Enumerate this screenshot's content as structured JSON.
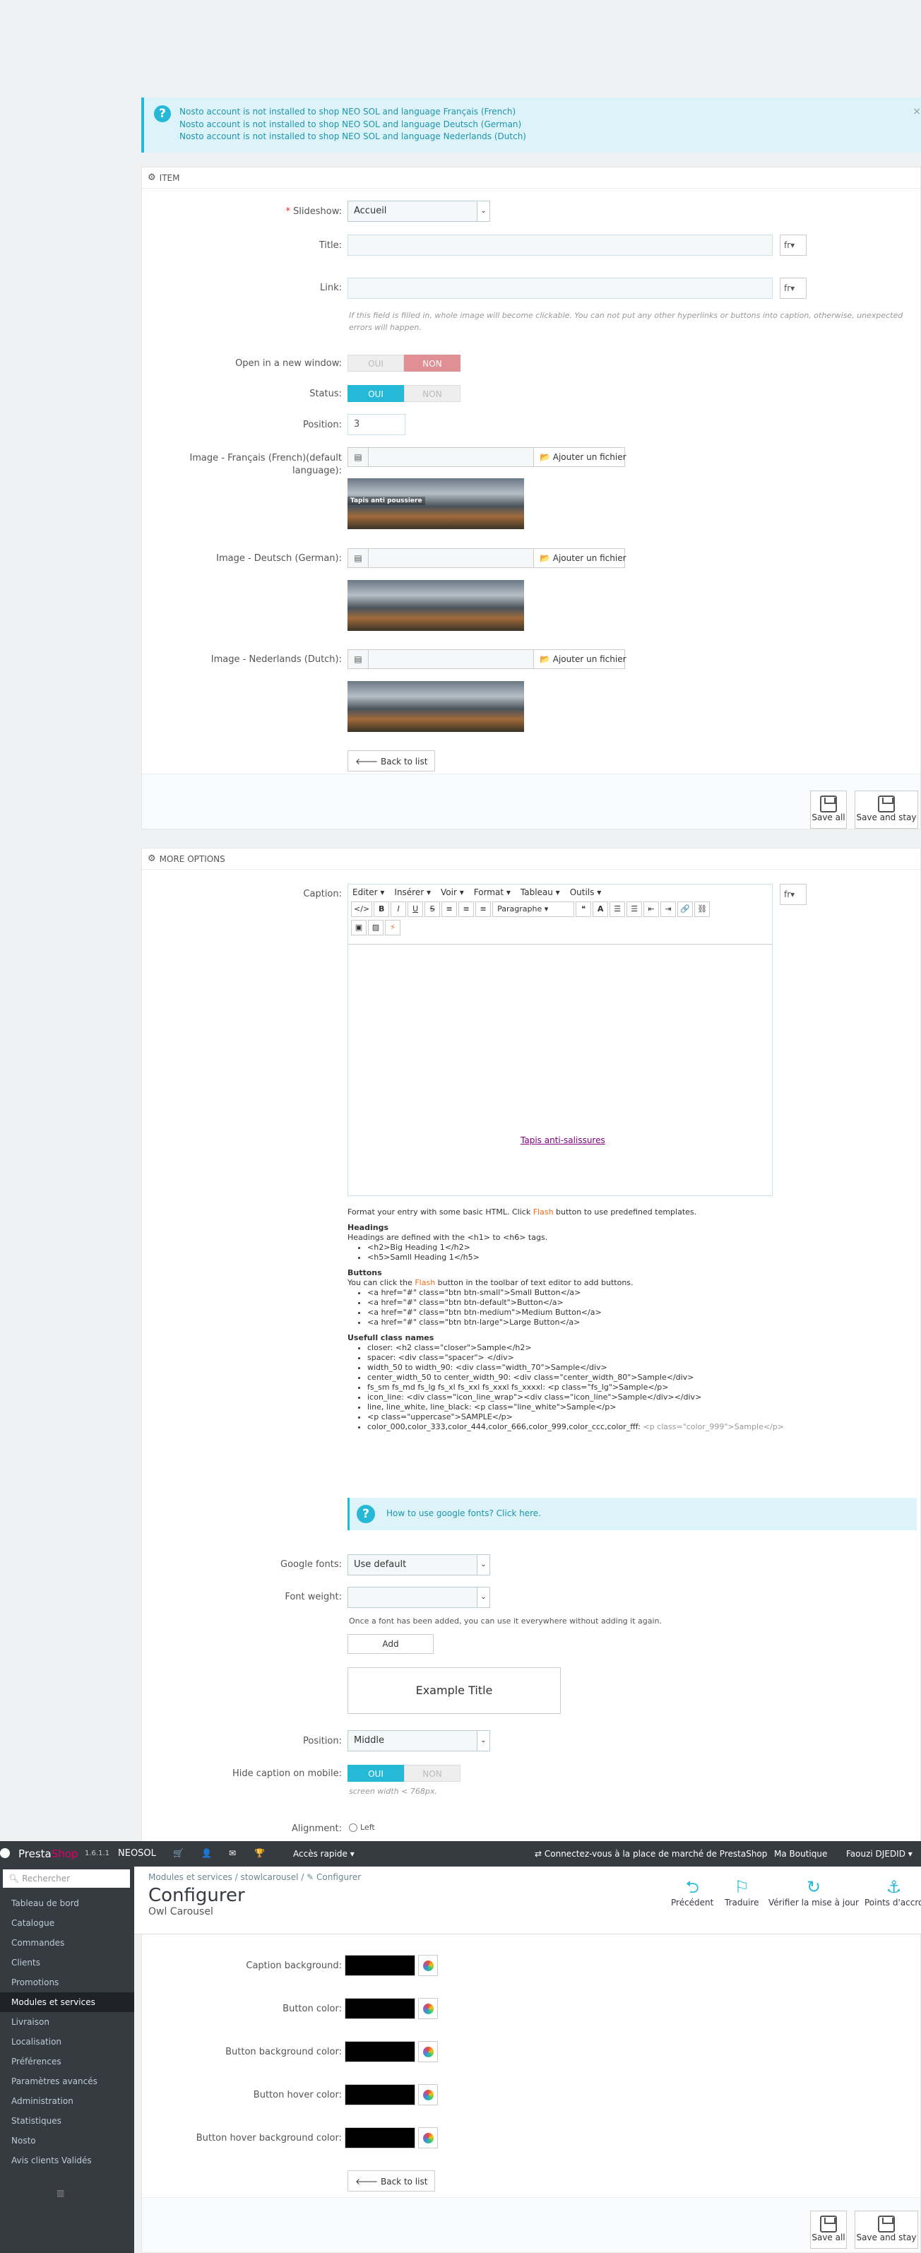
{
  "alert": {
    "lines": [
      "Nosto account is not installed to shop NEO SOL and language Français (French)",
      "Nosto account is not installed to shop NEO SOL and language Deutsch (German)",
      "Nosto account is not installed to shop NEO SOL and language Nederlands (Dutch)"
    ],
    "close": "×"
  },
  "item_panel": {
    "heading": "ITEM",
    "slideshow_label": "Slideshow:",
    "slideshow_value": "Accueil",
    "title_label": "Title:",
    "link_label": "Link:",
    "lang": "fr",
    "link_hint": "If this field is filled in, whole image will become clickable. You can not put any other hyperlinks or buttons into caption, otherwise, unexpected errors will happen.",
    "open_new_label": "Open in a new window:",
    "status_label": "Status:",
    "oui": "OUI",
    "non": "NON",
    "position_label": "Position:",
    "position_value": "3",
    "image_fr_label_1": "Image - Français (French)(default",
    "image_fr_label_2": "language):",
    "image_de_label": "Image - Deutsch (German):",
    "image_nl_label": "Image - Nederlands (Dutch):",
    "add_file": "Ajouter un fichier",
    "thumb_text": "Tapis anti poussiere",
    "back": "Back to list",
    "save_all": "Save all",
    "save_stay": "Save and stay"
  },
  "options_panel": {
    "heading": "MORE OPTIONS",
    "caption_label": "Caption:",
    "lang": "fr",
    "menu": [
      "Editer ▾",
      "Insérer ▾",
      "Voir ▾",
      "Format ▾",
      "Tableau ▾",
      "Outils ▾"
    ],
    "paragraph": "Paragraphe",
    "editor_link": "Tapis anti-salissures",
    "help_intro_1": "Format your entry with some basic HTML. Click ",
    "help_flash": "Flash",
    "help_intro_2": " button to use predefined templates.",
    "headings_title": "Headings",
    "headings_text": "Headings are defined with the <h1> to <h6> tags.",
    "headings_items": [
      "<h2>Big Heading 1</h2>",
      "<h5>Samll Heading 1</h5>"
    ],
    "buttons_title": "Buttons",
    "buttons_text_1": "You can click the ",
    "buttons_text_2": " button in the toolbar of text editor to add buttons.",
    "buttons_items": [
      "<a href=\"#\" class=\"btn btn-small\">Small Button</a>",
      "<a href=\"#\" class=\"btn btn-default\">Button</a>",
      "<a href=\"#\" class=\"btn btn-medium\">Medium Button</a>",
      "<a href=\"#\" class=\"btn btn-large\">Large Button</a>"
    ],
    "classes_title": "Usefull class names",
    "classes_items": [
      "closer: <h2 class=\"closer\">Sample</h2>",
      "spacer: <div class=\"spacer\"> </div>",
      "width_50 to width_90: <div class=\"width_70\">Sample</div>",
      "center_width_50 to center_width_90: <div class=\"center_width_80\">Sample</div>",
      "fs_sm fs_md fs_lg fs_xl fs_xxl fs_xxxl fs_xxxxl: <p class=\"fs_lg\">Sample</p>",
      "icon_line: <div class=\"icon_line_wrap\"><div class=\"icon_line\">Sample</div></div>",
      "line, line_white, line_black: <p class=\"line_white\">Sample</p>",
      "<p class=\"uppercase\">SAMPLE</p>"
    ],
    "colors_item_1": "color_000,color_333,color_444,color_666,color_999,color_ccc,color_fff: ",
    "colors_item_2": "<p class=\"color_999\">Sample</p>",
    "gfont_help": "How to use google fonts? Click here.",
    "gfont_label": "Google fonts:",
    "gfont_value": "Use default",
    "weight_label": "Font weight:",
    "font_note": "Once a font has been added, you can use it everywhere without adding it again.",
    "add": "Add",
    "example": "Example Title",
    "position_label": "Position:",
    "position_value": "Middle",
    "hide_label": "Hide caption on mobile:",
    "screen_hint": "screen width < 768px.",
    "align_label": "Alignment:",
    "align_left": "Left",
    "caption_bg_label": "Caption background:",
    "button_color_label": "Button color:",
    "button_bg_label": "Button background color:",
    "button_hover_label": "Button hover color:",
    "button_hover_bg_label": "Button hover background color:"
  },
  "topbar": {
    "brand_1": "Presta",
    "brand_2": "Shop",
    "version": "1.6.1.1",
    "shop": "NEOSOL",
    "quick": "Accès rapide ▾",
    "marketplace": "Connectez-vous à la place de marché de PrestaShop",
    "myshop": "Ma Boutique",
    "user": "Faouzi DJEDID ▾"
  },
  "sidebar": {
    "search": "Rechercher",
    "items": [
      "Tableau de bord",
      "Catalogue",
      "Commandes",
      "Clients",
      "Promotions",
      "Modules et services",
      "Livraison",
      "Localisation",
      "Préférences",
      "Paramètres avancés",
      "Administration",
      "Statistiques",
      "Nosto",
      "Avis clients Validés"
    ]
  },
  "pagehead": {
    "crumb_1": "Modules et services",
    "crumb_2": "stowlcarousel",
    "crumb_3": "Configurer",
    "title": "Configurer",
    "subtitle": "Owl Carousel",
    "tools": [
      "Précédent",
      "Traduire",
      "Vérifier la mise à jour",
      "Points d'accro"
    ]
  }
}
